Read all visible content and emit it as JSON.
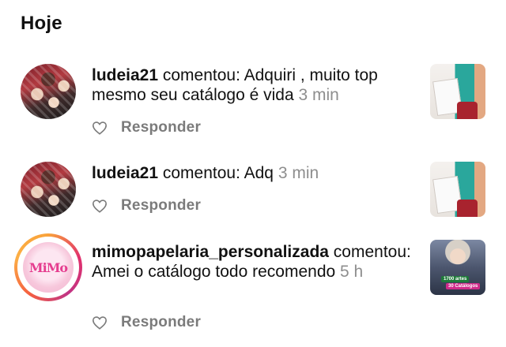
{
  "section_title": "Hoje",
  "notifications": [
    {
      "username": "ludeia21",
      "action": " comentou: Adquiri , muito top mesmo seu catálogo é vida ",
      "time": "3 min",
      "reply_label": "Responder",
      "avatar_icon": "family-photo-avatar",
      "thumbnail_icon": "post-thumbnail-craft"
    },
    {
      "username": "ludeia21",
      "action": " comentou: Adq ",
      "time": "3 min",
      "reply_label": "Responder",
      "avatar_icon": "family-photo-avatar",
      "thumbnail_icon": "post-thumbnail-craft"
    },
    {
      "username": "mimopapelaria_personalizada",
      "action": " comentou: Amei o catálogo todo recomendo ",
      "time": "5 h",
      "reply_label": "Responder",
      "avatar_icon": "mimo-papelaria-logo",
      "avatar_logo_text": "MiMo",
      "thumbnail_icon": "post-thumbnail-promo",
      "thumbnail_badges": [
        "1700 artes",
        "30 Catálogos"
      ]
    }
  ],
  "colors": {
    "text": "#111111",
    "muted": "#8e8e8e",
    "reply": "#7b7b7b",
    "story_ring": [
      "#f9a23a",
      "#e1306c",
      "#c13584",
      "#fcaf45"
    ]
  }
}
